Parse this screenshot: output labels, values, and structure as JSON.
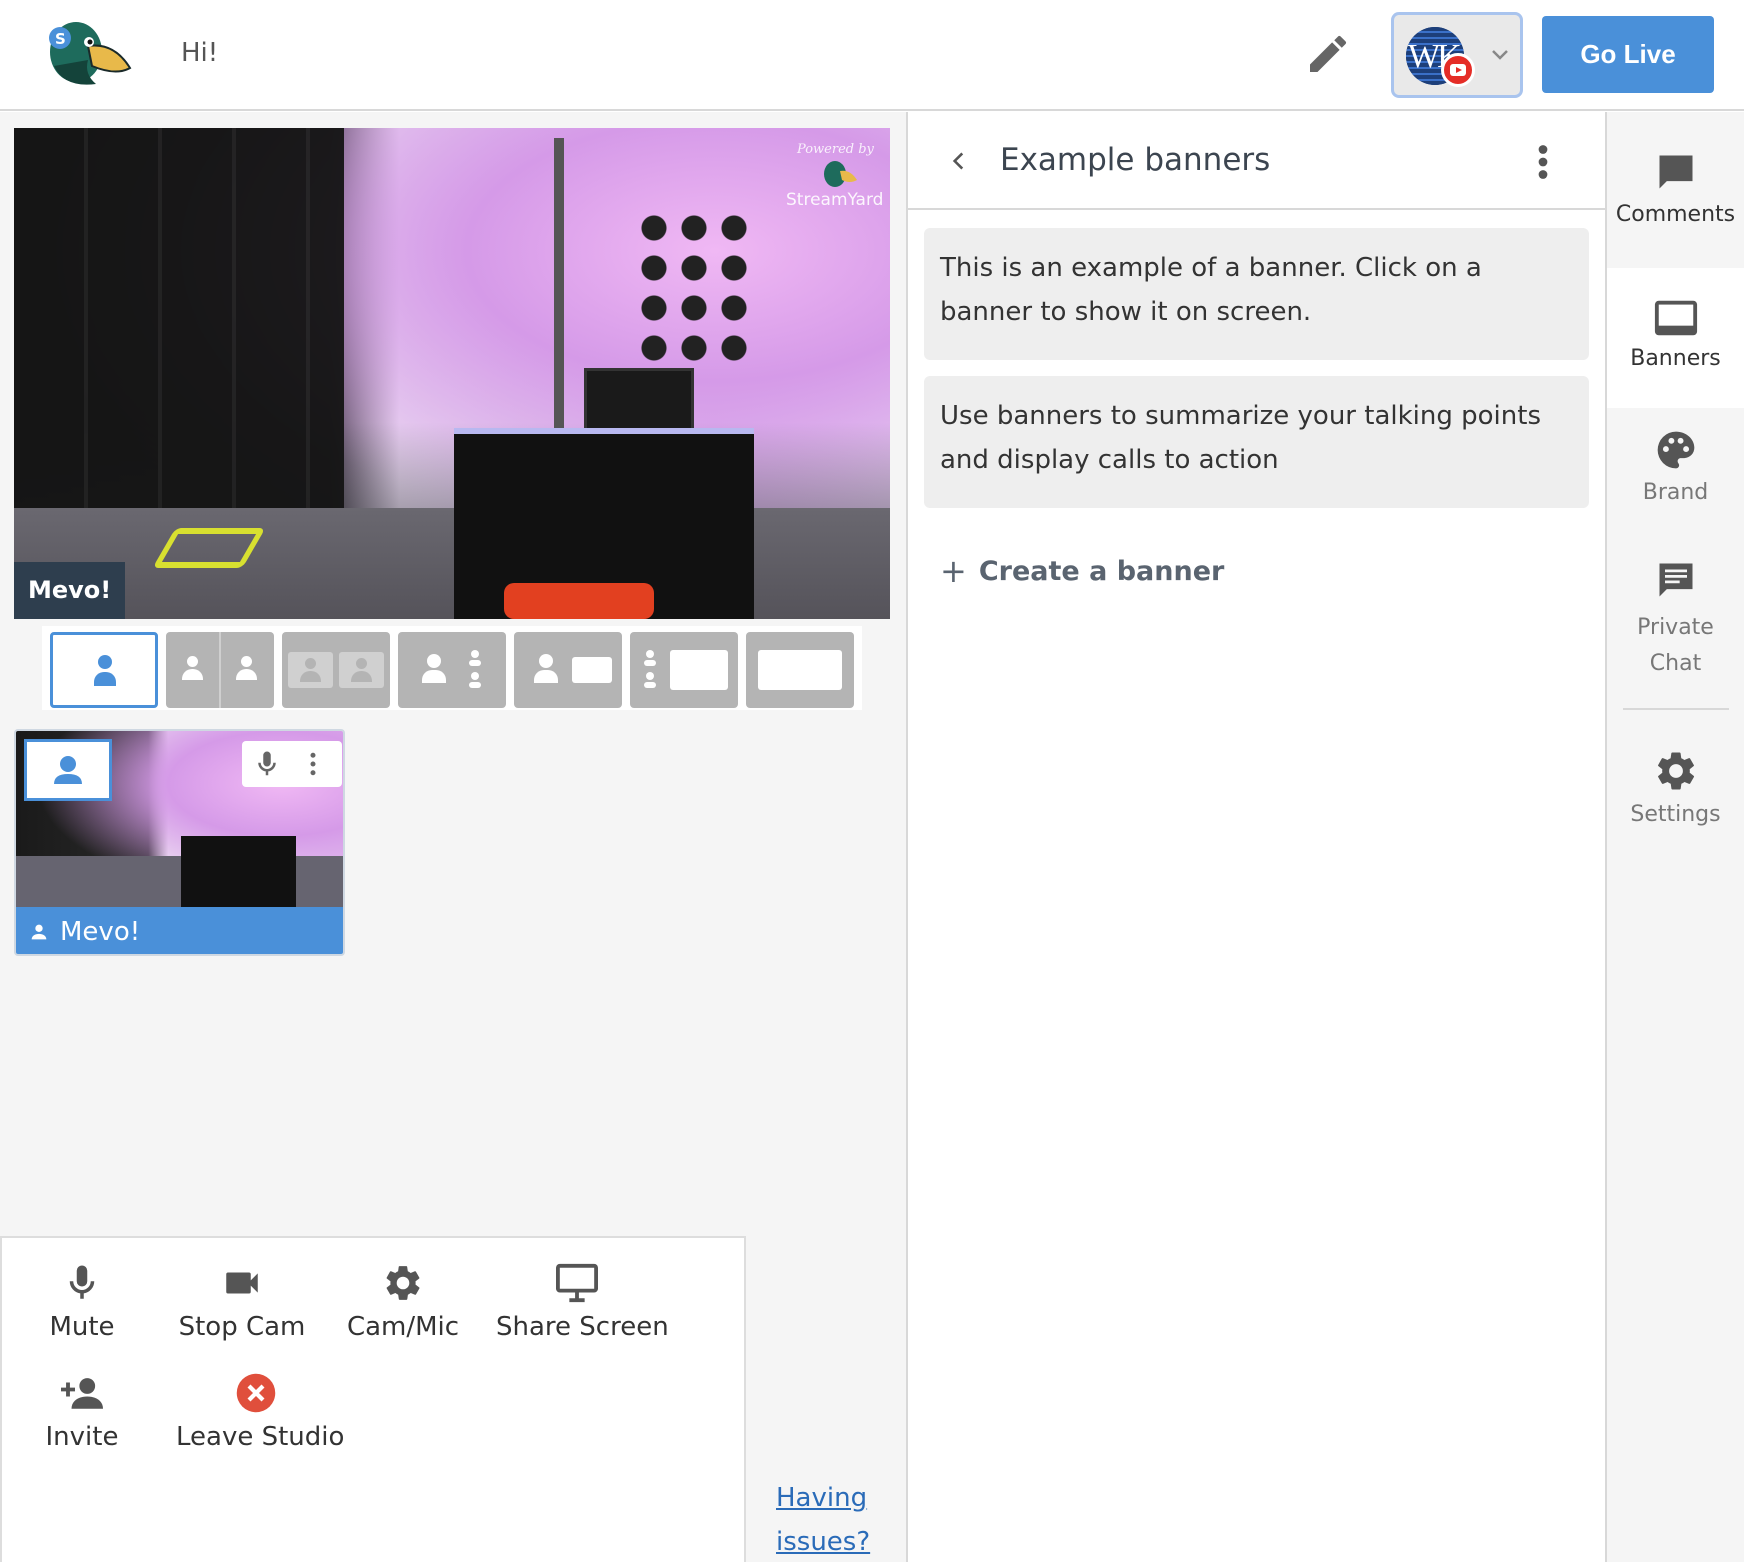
{
  "header": {
    "greeting": "Hi!",
    "go_live_label": "Go Live",
    "destination_avatar_text": "WK"
  },
  "stage": {
    "participant_label": "Mevo!",
    "watermark_powered": "Powered by",
    "watermark_brand": "StreamYard"
  },
  "layouts": [
    {
      "name": "solo",
      "active": true
    },
    {
      "name": "cropped"
    },
    {
      "name": "group"
    },
    {
      "name": "leader"
    },
    {
      "name": "screen"
    },
    {
      "name": "picture-in-picture"
    },
    {
      "name": "screen-only"
    }
  ],
  "tile": {
    "name": "Mevo!"
  },
  "controls": {
    "mute": "Mute",
    "stop_cam": "Stop Cam",
    "cam_mic": "Cam/Mic",
    "share_screen": "Share Screen",
    "invite": "Invite",
    "leave_studio": "Leave Studio",
    "having_issues_1": "Having",
    "having_issues_2": "issues?"
  },
  "panel": {
    "title": "Example banners",
    "banners": [
      "This is an example of a banner. Click on a banner to show it on screen.",
      "Use banners to summarize your talking points and display calls to action"
    ],
    "create_label": "Create a banner"
  },
  "sidebar": {
    "items": [
      {
        "label": "Comments",
        "icon": "comment-icon"
      },
      {
        "label": "Banners",
        "icon": "banner-icon",
        "active": true
      },
      {
        "label": "Brand",
        "icon": "palette-icon"
      },
      {
        "label": "Private",
        "label2": "Chat",
        "icon": "chat-icon"
      },
      {
        "label": "Settings",
        "icon": "gear-icon"
      }
    ]
  },
  "colors": {
    "accent": "#4a90d9",
    "leave": "#e04f3c",
    "youtube": "#e52d27"
  }
}
